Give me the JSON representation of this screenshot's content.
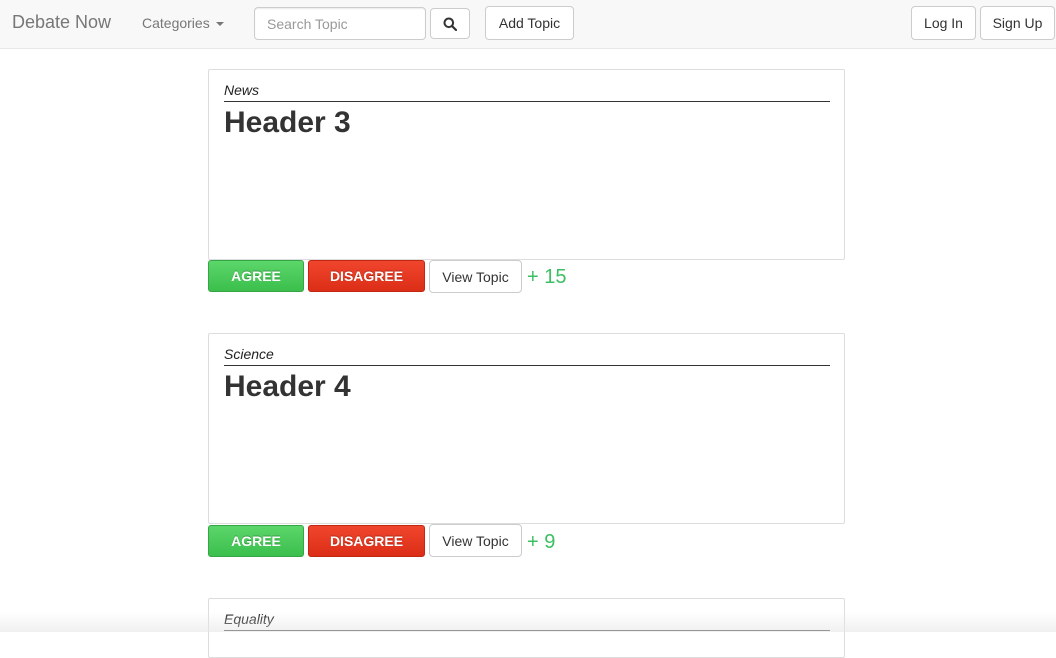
{
  "navbar": {
    "brand": "Debate Now",
    "categories_label": "Categories",
    "search_placeholder": "Search Topic",
    "add_topic_label": "Add Topic",
    "login_label": "Log In",
    "signup_label": "Sign Up"
  },
  "topics": [
    {
      "category": "News",
      "title": "Header 3",
      "agree_label": "AGREE",
      "disagree_label": "DISAGREE",
      "view_label": "View Topic",
      "score": "+ 15"
    },
    {
      "category": "Science",
      "title": "Header 4",
      "agree_label": "AGREE",
      "disagree_label": "DISAGREE",
      "view_label": "View Topic",
      "score": "+ 9"
    },
    {
      "category": "Equality"
    }
  ],
  "colors": {
    "agree": "#3bbf4d",
    "disagree": "#dc2e17",
    "score": "#3bbf62"
  },
  "icons": {
    "search": "search-icon",
    "dropdown": "caret-down-icon"
  }
}
